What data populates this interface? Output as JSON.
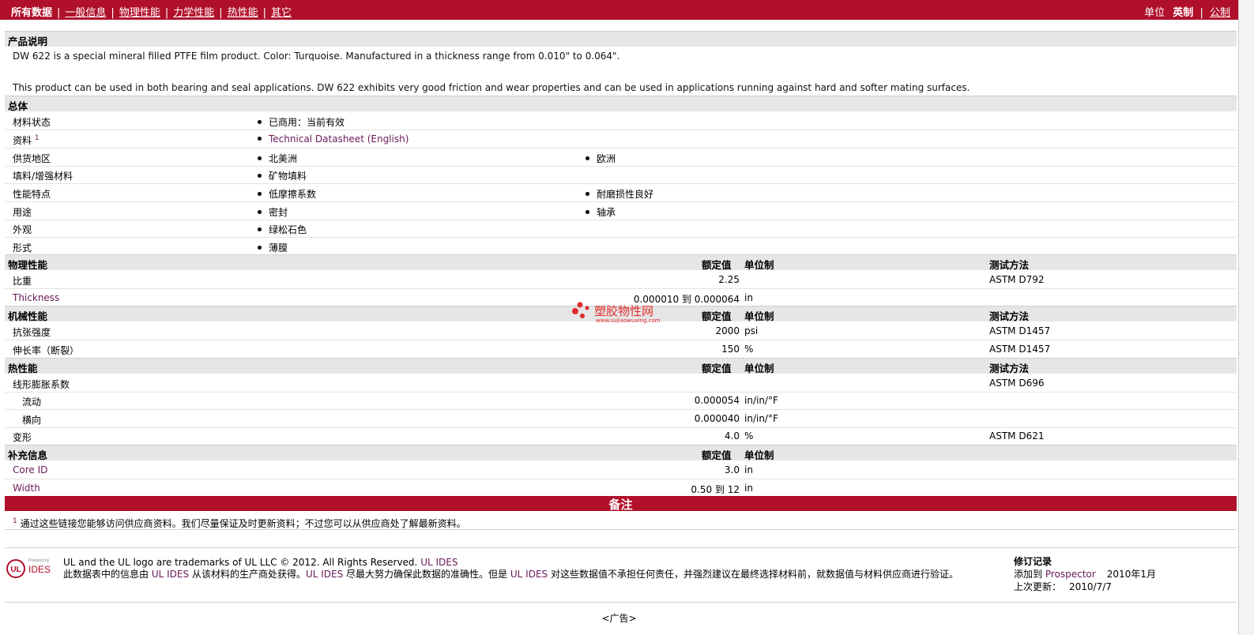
{
  "nav": {
    "items": [
      "所有数据",
      "一般信息",
      "物理性能",
      "力学性能",
      "热性能",
      "其它"
    ],
    "separator": "|",
    "units_label": "单位",
    "unit_imperial": "英制",
    "unit_metric": "公制"
  },
  "product": {
    "section_title": "产品说明",
    "desc1": "DW 622 is a special mineral filled PTFE film product. Color: Turquoise. Manufactured in a thickness range from 0.010\" to 0.064\".",
    "desc2": "This product can be used in both bearing and seal applications. DW 622 exhibits very good friction and wear properties and can be used in applications running against hard and softer mating surfaces."
  },
  "general": {
    "title": "总体",
    "rows": [
      {
        "label": "材料状态",
        "b1": "已商用：当前有效",
        "b2": ""
      },
      {
        "label": "资料",
        "sup": "1",
        "b1": "Technical Datasheet (English)",
        "b2": ""
      },
      {
        "label": "供货地区",
        "b1": "北美洲",
        "b2": "欧洲"
      },
      {
        "label": "填料/增强材料",
        "b1": "矿物填料",
        "b2": ""
      },
      {
        "label": "性能特点",
        "b1": "低摩擦系数",
        "b2": "耐磨损性良好"
      },
      {
        "label": "用途",
        "b1": "密封",
        "b2": "轴承"
      },
      {
        "label": "外观",
        "b1": "绿松石色",
        "b2": ""
      },
      {
        "label": "形式",
        "b1": "薄膜",
        "b2": ""
      }
    ]
  },
  "headers": {
    "value": "额定值",
    "unit": "单位制",
    "test": "测试方法"
  },
  "physical": {
    "title": "物理性能",
    "rows": [
      {
        "label": "比重",
        "val": "2.25",
        "unit": "",
        "test": "ASTM D792"
      },
      {
        "label": "Thickness",
        "val": "0.000010 到  0.000064",
        "unit": "in",
        "test": ""
      }
    ]
  },
  "mechanical": {
    "title": "机械性能",
    "rows": [
      {
        "label": "抗张强度",
        "val": "2000",
        "unit": "psi",
        "test": "ASTM D1457"
      },
      {
        "label": "伸长率（断裂）",
        "val": "150",
        "unit": "%",
        "test": "ASTM D1457"
      }
    ]
  },
  "thermal": {
    "title": "热性能",
    "rows": [
      {
        "label": "线形膨胀系数",
        "val": "",
        "unit": "",
        "test": "ASTM D696"
      },
      {
        "label": "流动",
        "val": "0.000054",
        "unit": "in/in/°F",
        "test": ""
      },
      {
        "label": "横向",
        "val": "0.000040",
        "unit": "in/in/°F",
        "test": ""
      },
      {
        "label": "变形",
        "val": "4.0",
        "unit": "%",
        "test": "ASTM D621"
      }
    ]
  },
  "supplementary": {
    "title": "补充信息",
    "rows": [
      {
        "label": "Core ID",
        "val": "3.0",
        "unit": "in"
      },
      {
        "label": "Width",
        "val": "0.50 到  12",
        "unit": "in"
      }
    ]
  },
  "notes": {
    "title": "备注",
    "sup": "1",
    "text": "通过这些链接您能够访问供应商资料。我们尽量保证及时更新资料；不过您可以从供应商处了解最新资料。"
  },
  "watermark": {
    "text": "塑胶物性网",
    "url": "www.sujiaowuxing.com"
  },
  "footer": {
    "line1_a": "UL and the UL logo are trademarks of UL LLC © 2012. All Rights Reserved.",
    "line1_b": "UL IDES",
    "line2_a": "此数据表中的信息由",
    "line2_b": "UL IDES",
    "line2_c": "从该材料的生产商处获得。",
    "line2_d": "UL IDES",
    "line2_e": "尽最大努力确保此数据的准确性。但是",
    "line2_f": "UL IDES",
    "line2_g": "对这些数据值不承担任何责任，并强烈建议在最终选择材料前，就数据值与材料供应商进行验证。",
    "logo_powered": "Powered by",
    "logo_ul": "UL",
    "logo_ides": "IDES"
  },
  "revision": {
    "title": "修订记录",
    "added_label": "添加到",
    "added_link": "Prospector",
    "added_date": "2010年1月",
    "updated_label": "上次更新：",
    "updated_date": "2010/7/7"
  },
  "ad": "<广告>"
}
